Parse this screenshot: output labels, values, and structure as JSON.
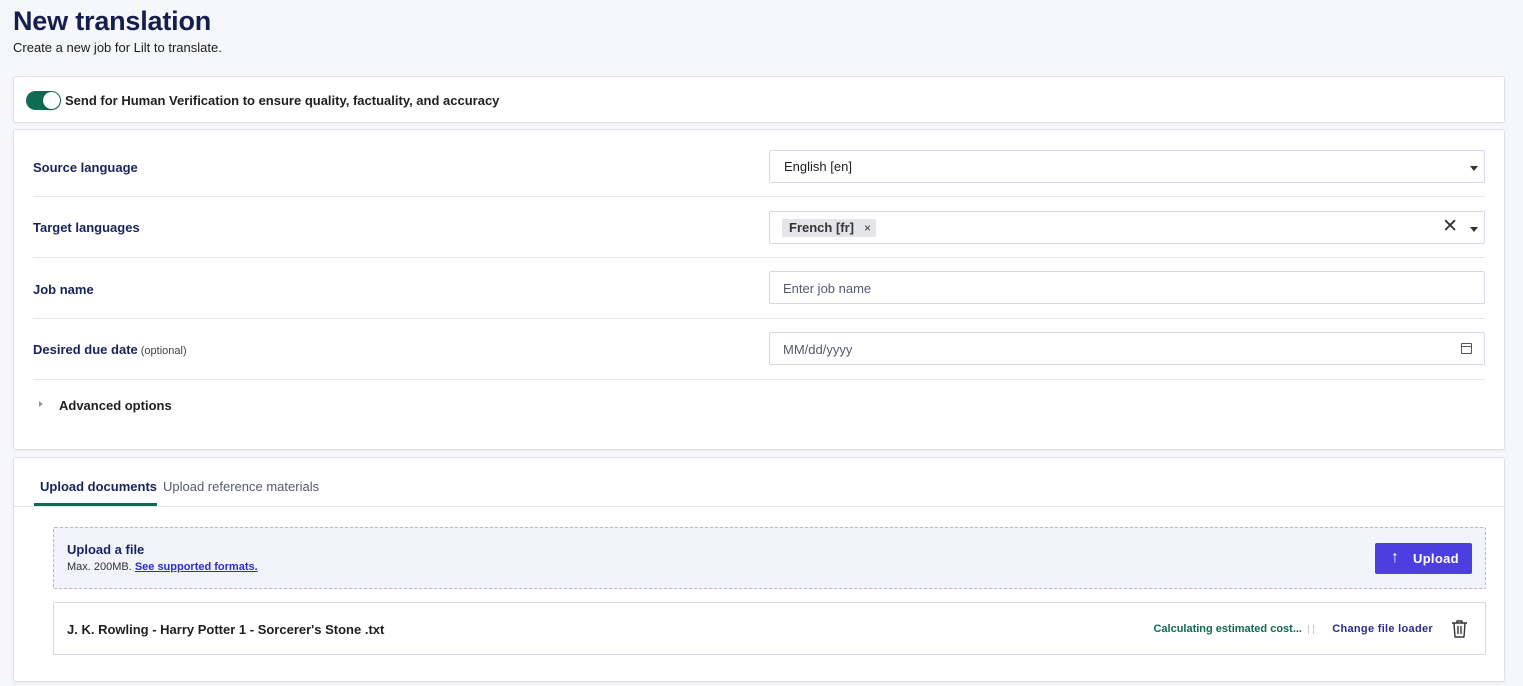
{
  "header": {
    "title": "New translation",
    "subtitle": "Create a new job for Lilt to translate."
  },
  "verification": {
    "toggle_on": true,
    "label": "Send for Human Verification to ensure quality, factuality, and accuracy"
  },
  "form": {
    "source_language": {
      "label": "Source language",
      "value": "English [en]"
    },
    "target_languages": {
      "label": "Target languages",
      "chips": [
        "French [fr]"
      ],
      "chip_remove": "×",
      "clear": "✕"
    },
    "job_name": {
      "label": "Job name",
      "placeholder": "Enter job name"
    },
    "due_date": {
      "label": "Desired due date",
      "optional": "(optional)",
      "placeholder": "MM/dd/yyyy"
    },
    "advanced": {
      "label": "Advanced options"
    }
  },
  "upload": {
    "tabs": [
      "Upload documents",
      "Upload reference materials"
    ],
    "active_tab": "Upload documents",
    "dropzone": {
      "title": "Upload a file",
      "limit": "Max. 200MB.",
      "formats_link": "See supported formats."
    },
    "upload_button": "Upload",
    "files": [
      {
        "name": "J. K. Rowling - Harry Potter 1 - Sorcerer's Stone .txt",
        "status": "Calculating estimated cost...",
        "change_loader": "Change file loader"
      }
    ]
  },
  "colors": {
    "accent_green": "#0f6b52",
    "primary_button": "#4b3fe0",
    "title_navy": "#141f4f"
  }
}
